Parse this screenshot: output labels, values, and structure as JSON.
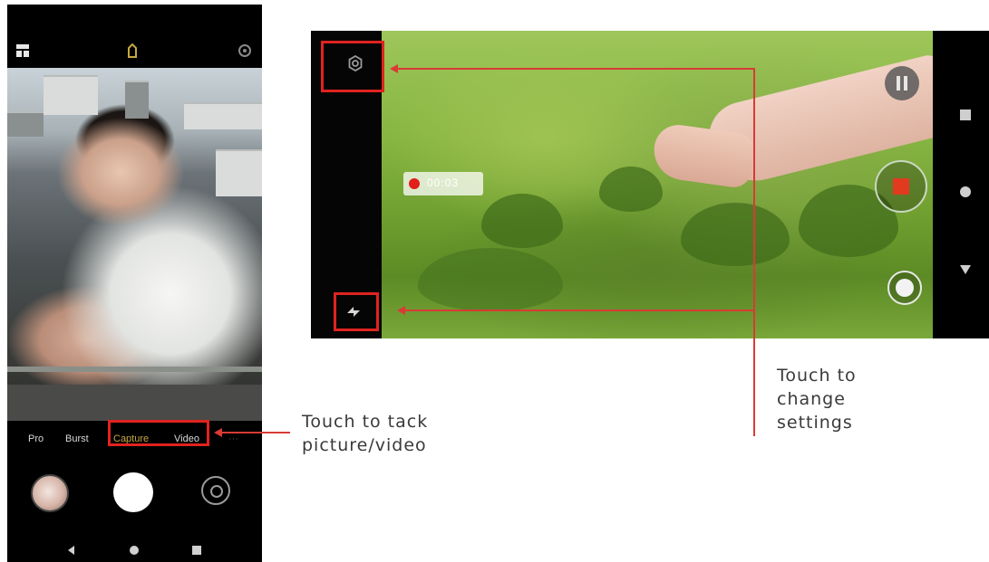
{
  "portrait_phone": {
    "top_icons": [
      "menu-grid-icon",
      "flash-icon",
      "settings-icon"
    ],
    "modes": [
      {
        "label": "Pro",
        "active": false
      },
      {
        "label": "Burst",
        "active": false
      },
      {
        "label": "Capture",
        "active": true
      },
      {
        "label": "Video",
        "active": false
      }
    ],
    "nav_icons": [
      "back-icon",
      "home-icon",
      "recents-icon"
    ]
  },
  "landscape_phone": {
    "recording_time": "00:03",
    "icons": [
      "settings-icon",
      "flash-icon",
      "pause-icon",
      "stop-record-icon",
      "snapshot-icon"
    ],
    "nav_icons": [
      "recents-icon",
      "home-icon",
      "back-icon"
    ]
  },
  "annotations": {
    "capture_label": "Touch to tack picture/video",
    "capture_label_line1": "Touch to tack",
    "capture_label_line2": "picture/video",
    "settings_label_line1": "Touch to",
    "settings_label_line2": "change",
    "settings_label_line3": "settings"
  },
  "colors": {
    "highlight_red": "#e0231f",
    "active_mode": "#c8a642",
    "record_red": "#e0201a"
  }
}
